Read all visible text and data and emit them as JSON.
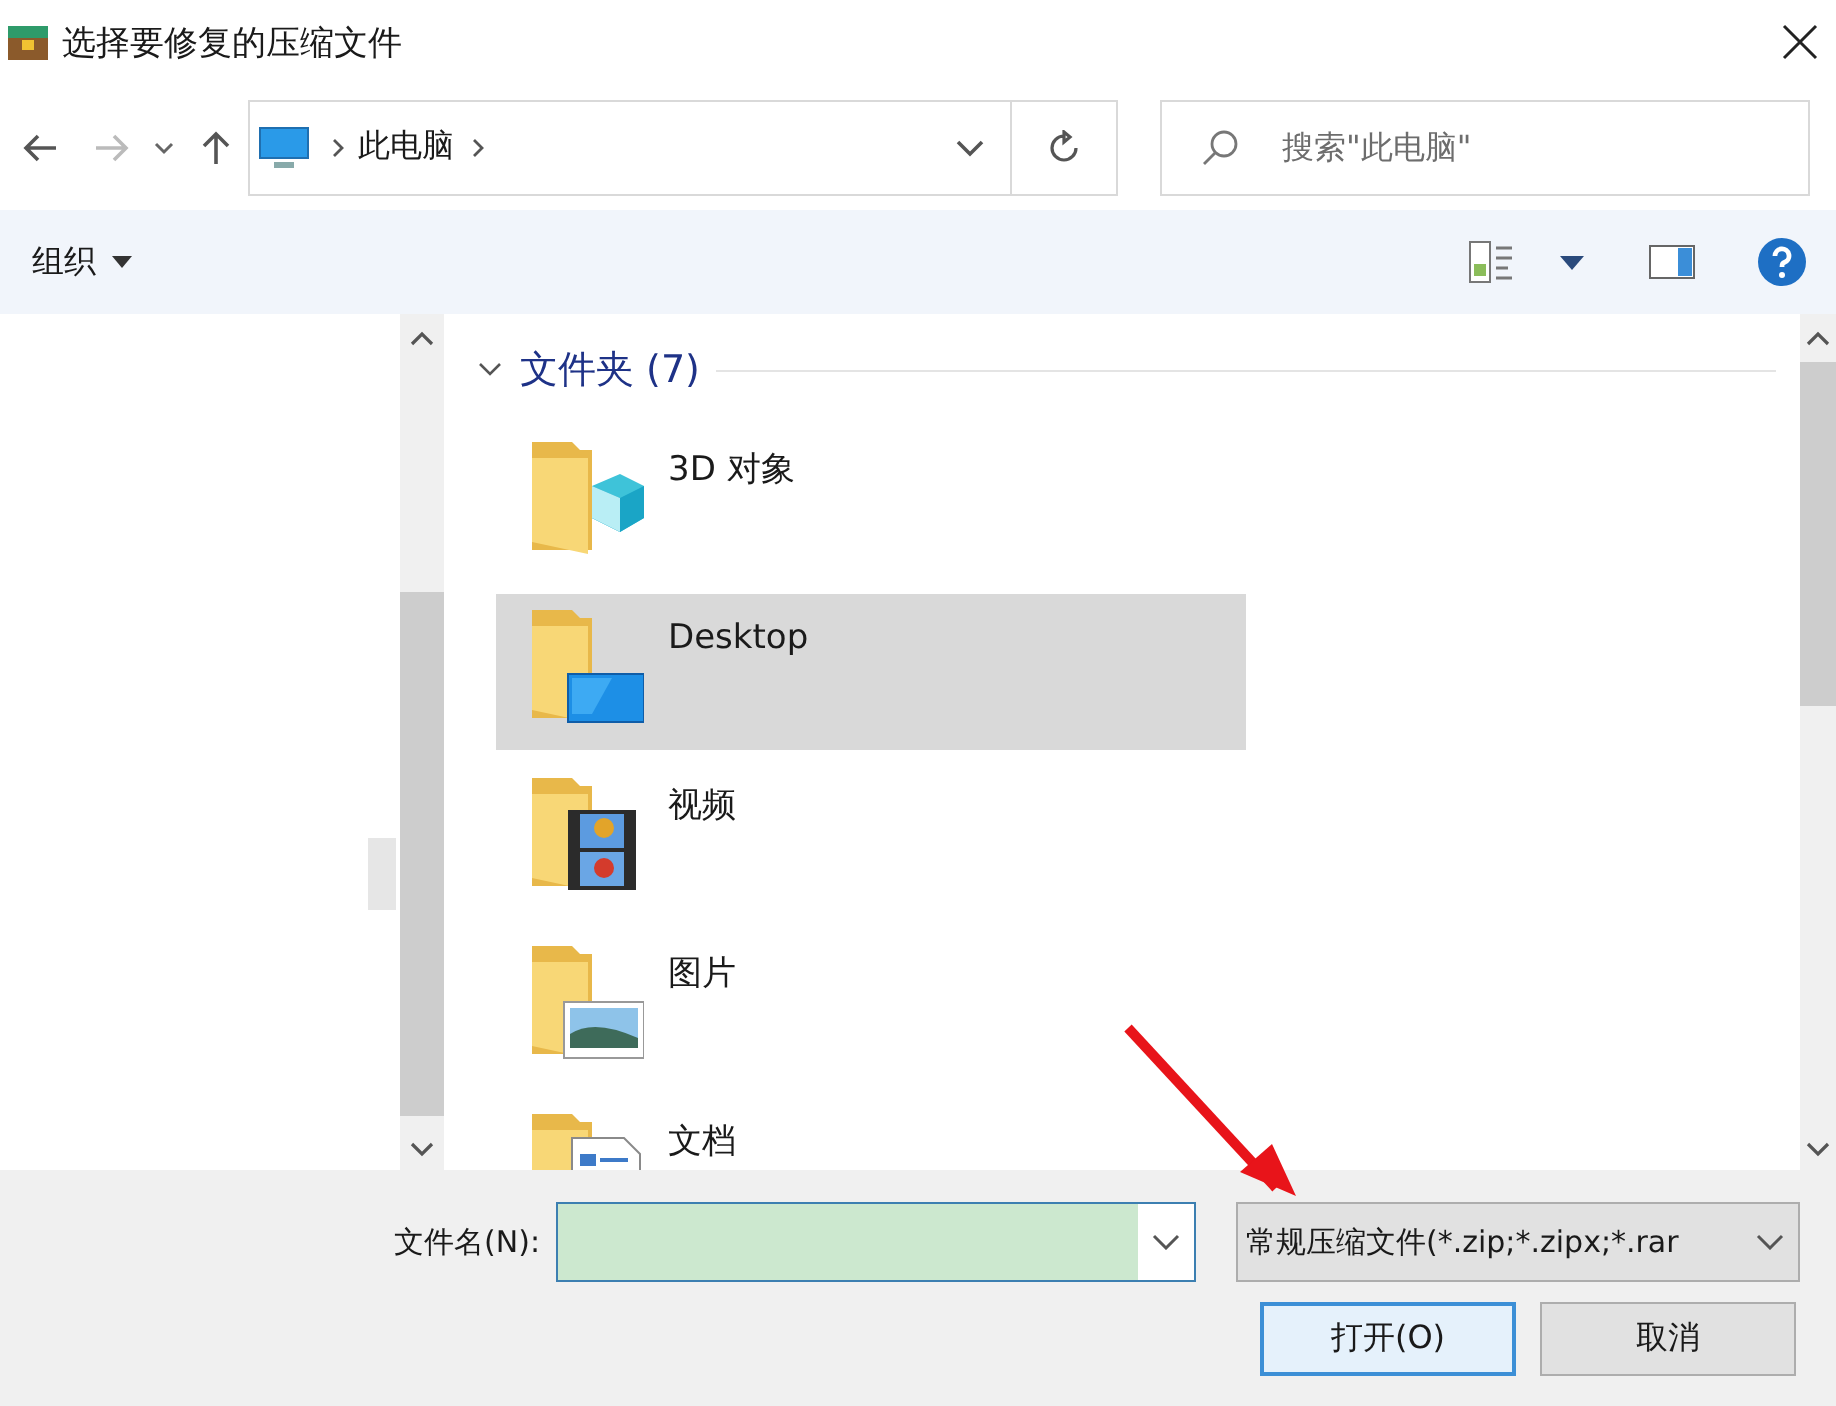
{
  "window": {
    "title": "选择要修复的压缩文件"
  },
  "address": {
    "location": "此电脑"
  },
  "search": {
    "placeholder": "搜索\"此电脑\""
  },
  "toolbar": {
    "organize": "组织"
  },
  "group": {
    "label": "文件夹 (7)",
    "expanded": true
  },
  "items": [
    {
      "name": "3D 对象",
      "kind": "cube",
      "selected": false
    },
    {
      "name": "Desktop",
      "kind": "desktop",
      "selected": true
    },
    {
      "name": "视频",
      "kind": "video",
      "selected": false
    },
    {
      "name": "图片",
      "kind": "pictures",
      "selected": false
    },
    {
      "name": "文档",
      "kind": "documents",
      "selected": false
    }
  ],
  "file_name": {
    "label": "文件名(N):"
  },
  "file_type": {
    "value": "常规压缩文件(*.zip;*.zipx;*.rar"
  },
  "buttons": [
    {
      "label": "打开(O)",
      "kind": "default"
    },
    {
      "label": "取消",
      "kind": "normal"
    }
  ]
}
